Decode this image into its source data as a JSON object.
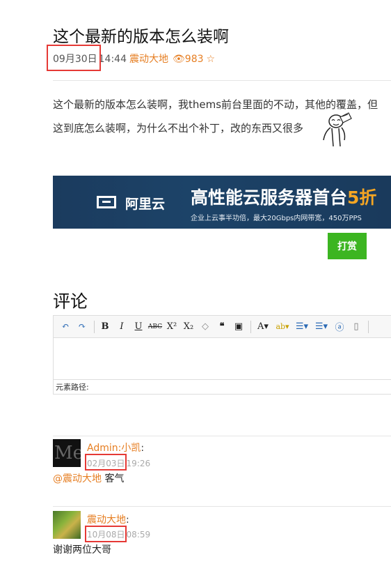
{
  "post": {
    "title": "这个最新的版本怎么装啊",
    "date": "09月30日",
    "time": "14:44",
    "author": "震动大地",
    "view_icon": "eye-icon",
    "views": "983",
    "star_icon": "star-outline-icon",
    "body_line1": "这个最新的版本怎么装啊，我thems前台里面的不动，其他的覆盖，但",
    "body_line2": "这到底怎么装啊，为什么不出个补丁，改的东西又很多"
  },
  "banner": {
    "brand": "阿里云",
    "headline": "高性能云服务器首台",
    "headline_highlight": "5折",
    "sub": "企业上云事半功倍，最大20Gbps内网带宽，450万PPS"
  },
  "tip_button": "打赏",
  "comments": {
    "heading": "评论",
    "editor": {
      "tools": [
        "undo",
        "redo",
        "bold",
        "italic",
        "underline",
        "strikethrough",
        "superscript",
        "subscript",
        "eraser",
        "blockquote",
        "paste",
        "font-color",
        "highlight",
        "ordered-list",
        "unordered-list",
        "select-all",
        "clear-doc"
      ],
      "element_path_label": "元素路径:"
    },
    "items": [
      {
        "name": "Admin:小凯",
        "date": "02月03日",
        "time": "19:26",
        "reply_to": "@震动大地",
        "text": " 客气"
      },
      {
        "name": "震动大地",
        "date": "10月08日",
        "time": "08:59",
        "text": "谢谢两位大哥"
      }
    ]
  },
  "colors": {
    "accent": "#e67e22",
    "highlight_box": "#e53935",
    "tip_button": "#3cb521"
  }
}
